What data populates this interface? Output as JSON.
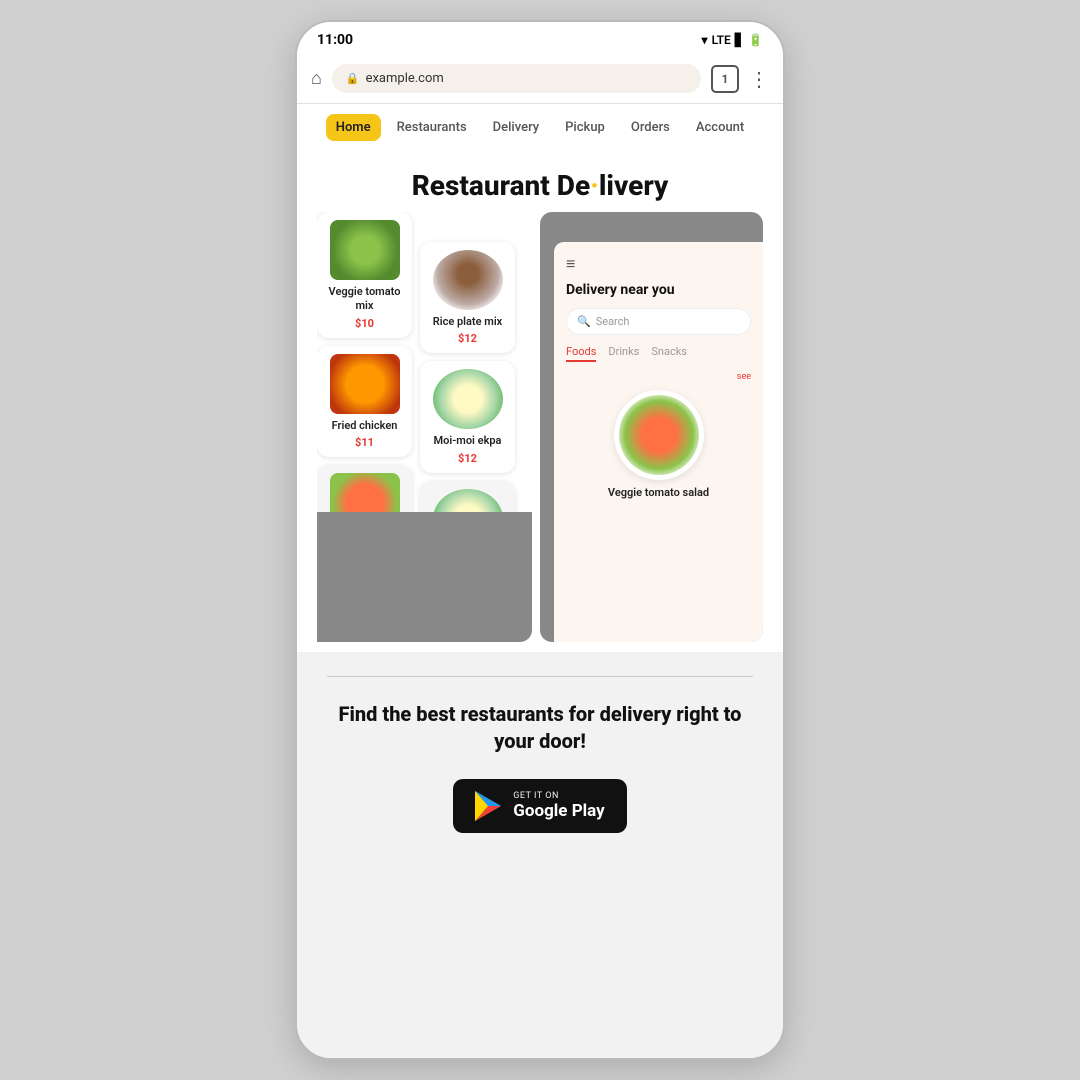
{
  "status_bar": {
    "time": "11:00",
    "lte_label": "LTE",
    "tab_count": "1"
  },
  "browser": {
    "url": "example.com"
  },
  "nav": {
    "items": [
      {
        "label": "Home",
        "active": true
      },
      {
        "label": "Restaurants",
        "active": false
      },
      {
        "label": "Delivery",
        "active": false
      },
      {
        "label": "Pickup",
        "active": false
      },
      {
        "label": "Orders",
        "active": false
      },
      {
        "label": "Account",
        "active": false
      }
    ]
  },
  "hero": {
    "title": "Restaurant Delivery"
  },
  "food_cards_col1": [
    {
      "name": "Veggie tomato mix",
      "price": "$10"
    },
    {
      "name": "Fried chicken",
      "price": "$11"
    },
    {
      "name": "",
      "price": ""
    }
  ],
  "food_cards_col2": [
    {
      "name": "Rice plate mix",
      "price": "$12"
    },
    {
      "name": "Moi-moi ekpa",
      "price": "$12"
    },
    {
      "name": "",
      "price": ""
    }
  ],
  "inner_app": {
    "title": "Delivery near you",
    "search_placeholder": "Search",
    "tabs": [
      "Foods",
      "Drinks",
      "Snacks"
    ],
    "active_tab": "Foods",
    "featured_item": "Veggie tomato salad"
  },
  "bottom": {
    "cta": "Find the best restaurants for delivery right to your door!",
    "play_store_small": "GET IT ON",
    "play_store_big": "Google Play"
  }
}
